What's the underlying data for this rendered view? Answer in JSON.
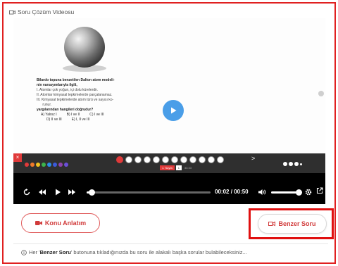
{
  "header": {
    "title": "Soru Çözüm Videosu"
  },
  "question": {
    "stem_line1": "Bilardo topuna benzetilen Dalton atom modeli-",
    "stem_line2": "nin varsayımlarıyla ilgili,",
    "items": [
      "I.   Atomlar çok yoğun, içi dolu kürelerdir.",
      "II.  Atomlar kimyasal tepkimelerde parçalanamaz.",
      "III. Kimyasal tepkimelerde atom türü ve sayısı ko-",
      "      runur."
    ],
    "prompt": "yargılarından hangileri doğrudur?",
    "answers_row1": [
      "A) Yalnız I",
      "B) I ve II",
      "C) I ve III"
    ],
    "answers_row2": [
      "D) II ve III",
      "E) I, II ve III"
    ]
  },
  "toolbar": {
    "close_label": "×",
    "page_label": "1. Sayfa",
    "page_value": "1",
    "page_extra": "33:33",
    "more_label": ">"
  },
  "player": {
    "current_time": "00:02",
    "duration": "00:50",
    "time_separator": "/",
    "progress_fraction": 0.04,
    "volume_fraction": 1.0
  },
  "buttons": {
    "konu_label": "Konu Anlatım",
    "benzer_label": "Benzer Soru"
  },
  "footer": {
    "prefix": "Her '",
    "bold": "Benzer Soru",
    "suffix": "' butonuna tıkladığınızda bu soru ile alakalı başka sorular bulabileceksiniz..."
  },
  "colors": {
    "accent_red": "#d13b3b",
    "play_blue": "#4a9ee8",
    "highlight_border": "#e01010"
  },
  "palette_colors": [
    "#e03a3a",
    "#f07a2a",
    "#f2c21f",
    "#3cb44b",
    "#2a8ee8",
    "#3b5bdb",
    "#8e44ad",
    "#6a4fd8"
  ]
}
